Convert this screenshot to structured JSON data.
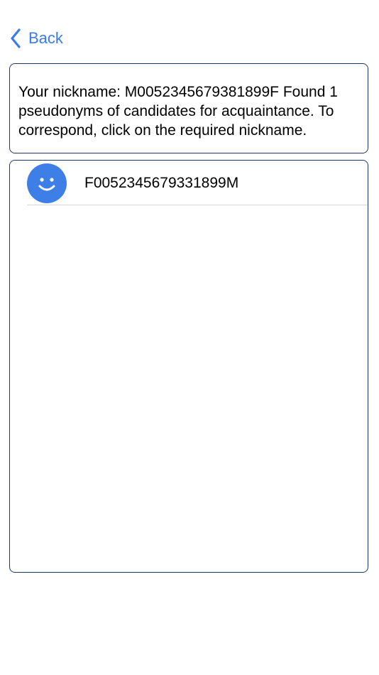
{
  "nav": {
    "back_label": "Back",
    "back_icon": "chevron-left-icon"
  },
  "info": {
    "text": "Your nickname: M0052345679381899F Found 1 pseudonyms of candidates for acquaintance. To correspond, click on the required nickname."
  },
  "candidates": [
    {
      "nickname": "F0052345679331899M",
      "avatar_icon": "smiley-face-icon"
    }
  ],
  "colors": {
    "accent": "#3b7be8",
    "avatar_bg": "#3d7fe6",
    "box_border": "#1f3a68",
    "separator": "#d6d6d6"
  }
}
